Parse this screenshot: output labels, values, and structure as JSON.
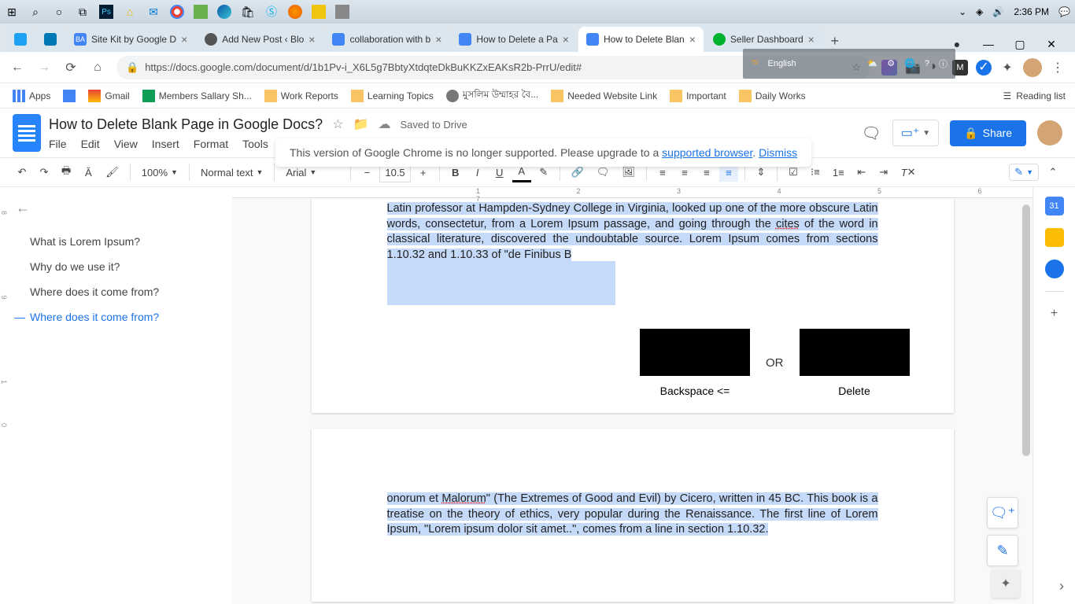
{
  "taskbar": {
    "time": "2:36 PM"
  },
  "tabs": [
    {
      "title": "",
      "favicon": "#1da1f2"
    },
    {
      "title": "",
      "favicon": "#0077b5"
    },
    {
      "title": "Site Kit by Google D",
      "favicon": "#4285f4"
    },
    {
      "title": "Add New Post ‹ Blo",
      "favicon": "#555"
    },
    {
      "title": "collaboration with b",
      "favicon": "#4285f4"
    },
    {
      "title": "How to Delete a Pa",
      "favicon": "#4285f4"
    },
    {
      "title": "How to Delete Blan",
      "favicon": "#4285f4",
      "active": true
    },
    {
      "title": "Seller Dashboard",
      "favicon": "#00b22d"
    }
  ],
  "url": "https://docs.google.com/document/d/1b1Pv-i_X6L5g7BbtyXtdqteDkBuKKZxEAKsR2b-PrrU/edit#",
  "lang_overlay": "English",
  "bookmarks": [
    {
      "label": "Apps",
      "type": "apps"
    },
    {
      "label": "",
      "type": "icon"
    },
    {
      "label": "Gmail",
      "type": "gmail"
    },
    {
      "label": "Members Sallary Sh...",
      "type": "sheet"
    },
    {
      "label": "Work Reports",
      "type": "folder"
    },
    {
      "label": "Learning Topics",
      "type": "folder"
    },
    {
      "label": "মুসলিম উম্মাহর বৈ...",
      "type": "icon"
    },
    {
      "label": "Needed Website Link",
      "type": "folder"
    },
    {
      "label": "Important",
      "type": "folder"
    },
    {
      "label": "Daily Works",
      "type": "folder"
    }
  ],
  "reading_list": "Reading list",
  "docs": {
    "title": "How to Delete Blank Page in Google Docs?",
    "saved": "Saved to Drive",
    "menu": [
      "File",
      "Edit",
      "View",
      "Insert",
      "Format",
      "Tools"
    ],
    "share": "Share"
  },
  "warning": {
    "text": "This version of Google Chrome is no longer supported. Please upgrade to a ",
    "link1": "supported browser",
    "sep": ". ",
    "link2": "Dismiss"
  },
  "toolbar": {
    "zoom": "100%",
    "style": "Normal text",
    "font": "Arial",
    "size": "10.5"
  },
  "outline": [
    {
      "label": "What is Lorem Ipsum?"
    },
    {
      "label": "Why do we use it?"
    },
    {
      "label": "Where does it come from?"
    },
    {
      "label": "Where does it come from?",
      "active": true
    }
  ],
  "ruler_h": "1 2 3 4 5 6 7",
  "ruler_v": "8 9 10",
  "doc": {
    "p1a": "Latin professor at Hampden-Sydney College in Virginia, looked up one of the more obscure Latin words, consectetur, from a Lorem Ipsum passage, and going through the ",
    "p1_cites": "cites",
    "p1b": " of the word in classical literature, discovered the undoubtable source. Lorem Ipsum comes from sections 1.10.32 and 1.10.33 of \"de Finibus B",
    "or": "OR",
    "backspace": "Backspace  <=",
    "delete": "Delete",
    "p2a": "onorum et ",
    "p2_mal": "Malorum",
    "p2b": "\" (The Extremes of Good and Evil) by Cicero, written in 45 BC. This book is a treatise on the theory of ethics, very popular during the Renaissance. The first line of Lorem Ipsum, \"Lorem ipsum dolor sit amet..\", comes from a line in section 1.10.32."
  }
}
